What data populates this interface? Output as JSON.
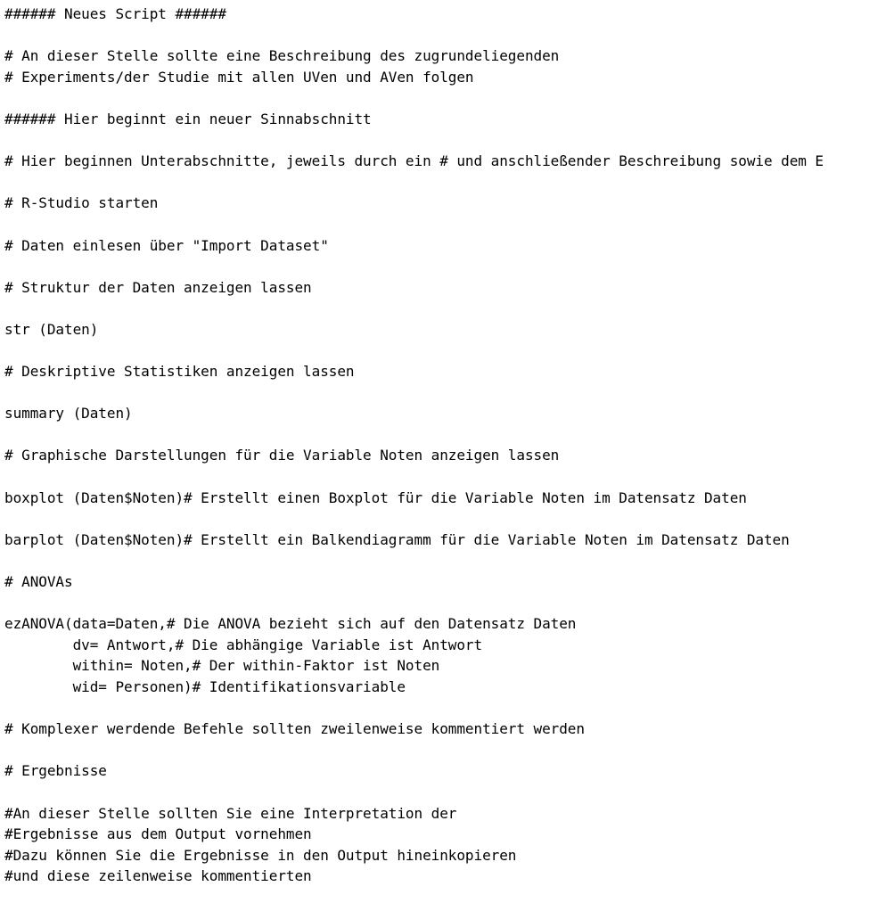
{
  "editor": {
    "lines": [
      "###### Neues Script ######",
      "",
      "# An dieser Stelle sollte eine Beschreibung des zugrundeliegenden",
      "# Experiments/der Studie mit allen UVen und AVen folgen",
      "",
      "###### Hier beginnt ein neuer Sinnabschnitt",
      "",
      "# Hier beginnen Unterabschnitte, jeweils durch ein # und anschließender Beschreibung sowie dem E",
      "",
      "# R-Studio starten",
      "",
      "# Daten einlesen über \"Import Dataset\"",
      "",
      "# Struktur der Daten anzeigen lassen",
      "",
      "str (Daten)",
      "",
      "# Deskriptive Statistiken anzeigen lassen",
      "",
      "summary (Daten)",
      "",
      "# Graphische Darstellungen für die Variable Noten anzeigen lassen",
      "",
      "boxplot (Daten$Noten)# Erstellt einen Boxplot für die Variable Noten im Datensatz Daten",
      "",
      "barplot (Daten$Noten)# Erstellt ein Balkendiagramm für die Variable Noten im Datensatz Daten",
      "",
      "# ANOVAs",
      "",
      "ezANOVA(data=Daten,# Die ANOVA bezieht sich auf den Datensatz Daten",
      "        dv= Antwort,# Die abhängige Variable ist Antwort",
      "        within= Noten,# Der within-Faktor ist Noten",
      "        wid= Personen)# Identifikationsvariable",
      "",
      "# Komplexer werdende Befehle sollten zweilenweise kommentiert werden",
      "",
      "# Ergebnisse",
      "",
      "#An dieser Stelle sollten Sie eine Interpretation der",
      "#Ergebnisse aus dem Output vornehmen",
      "#Dazu können Sie die Ergebnisse in den Output hineinkopieren",
      "#und diese zeilenweise kommentierten"
    ]
  }
}
